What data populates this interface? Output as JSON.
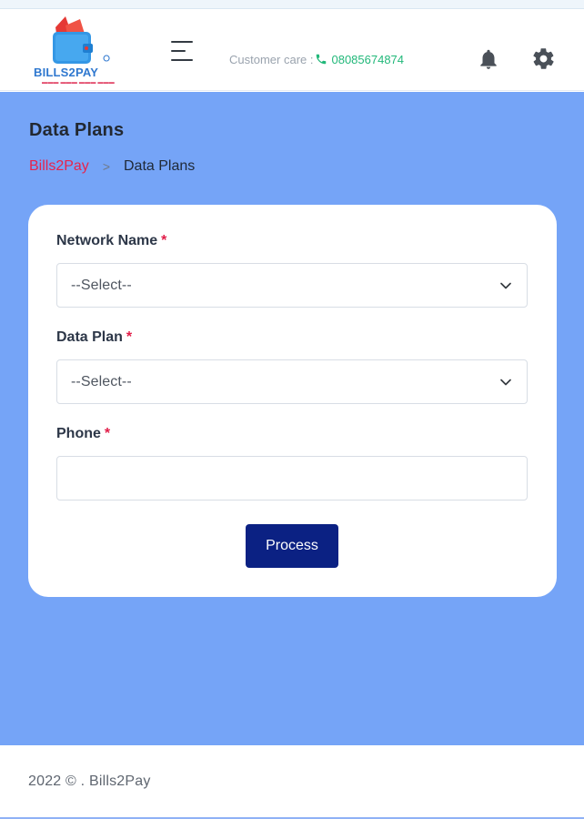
{
  "brand": {
    "logo_text": "BILLS2PAY",
    "logo_icon": "wallet-logo-icon",
    "accent_blue": "#2f78cf",
    "accent_red": "#e93d45"
  },
  "header": {
    "menu_icon": "menu-icon",
    "customer_care_label": "Customer care :",
    "phone_icon": "phone-icon",
    "phone_number": "08085674874",
    "notification_icon": "bell-icon",
    "settings_icon": "gear-icon"
  },
  "page": {
    "title": "Data Plans",
    "breadcrumb": {
      "home": "Bills2Pay",
      "separator": ">",
      "current": "Data Plans"
    }
  },
  "form": {
    "network_name": {
      "label": "Network Name",
      "required_mark": "*",
      "selected_value": "--Select--"
    },
    "data_plan": {
      "label": "Data Plan",
      "required_mark": "*",
      "selected_value": "--Select--"
    },
    "phone": {
      "label": "Phone",
      "required_mark": "*",
      "value": ""
    },
    "submit_label": "Process"
  },
  "footer": {
    "text": "2022 © . Bills2Pay"
  },
  "colors": {
    "page_background": "#75a4f7",
    "button_background": "#0b2183",
    "breadcrumb_link": "#e7234c",
    "phone_text": "#22b87a"
  }
}
